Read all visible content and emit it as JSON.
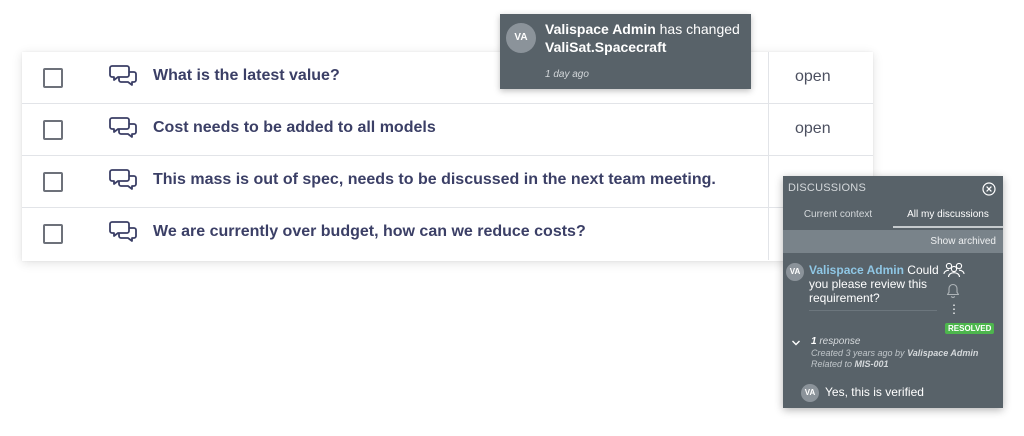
{
  "table": {
    "rows": [
      {
        "title": "What is the latest value?",
        "status": "open"
      },
      {
        "title": "Cost needs to be added to all models",
        "status": "open"
      },
      {
        "title": "This mass is out of spec, needs to be discussed in the next team meeting.",
        "status": ""
      },
      {
        "title": "We are currently over budget, how can we reduce costs?",
        "status": ""
      }
    ]
  },
  "notification": {
    "avatar_initials": "VA",
    "user": "Valispace Admin",
    "action": " has changed",
    "object": "ValiSat.Spacecraft",
    "time": "1 day ago"
  },
  "discussions_panel": {
    "title": "DISCUSSIONS",
    "tabs": [
      "Current context",
      "All my discussions"
    ],
    "active_tab": "All my discussions",
    "show_archived": "Show archived",
    "discussion": {
      "avatar_initials": "VA",
      "author": "Valispace Admin",
      "message": " Could you please review this requirement?",
      "status_badge": "RESOLVED",
      "response_count": "1",
      "response_label": " response",
      "created_prefix": "Created 3 years ago by ",
      "created_by": "Valispace Admin",
      "related_prefix": "Related to ",
      "related_to": "MIS-001",
      "reply": {
        "avatar_initials": "VA",
        "text": "Yes, this is verified"
      }
    }
  },
  "colors": {
    "title_text": "#3b3f66",
    "panel_bg": "#586269",
    "author_link": "#8fc7e5",
    "resolved_green": "#4db64d"
  },
  "icons": {
    "row": [
      "checkbox-icon",
      "comment-icon"
    ],
    "panel": [
      "close-icon",
      "participants-icon",
      "bell-icon",
      "more-icon",
      "chevron-down-icon"
    ]
  }
}
